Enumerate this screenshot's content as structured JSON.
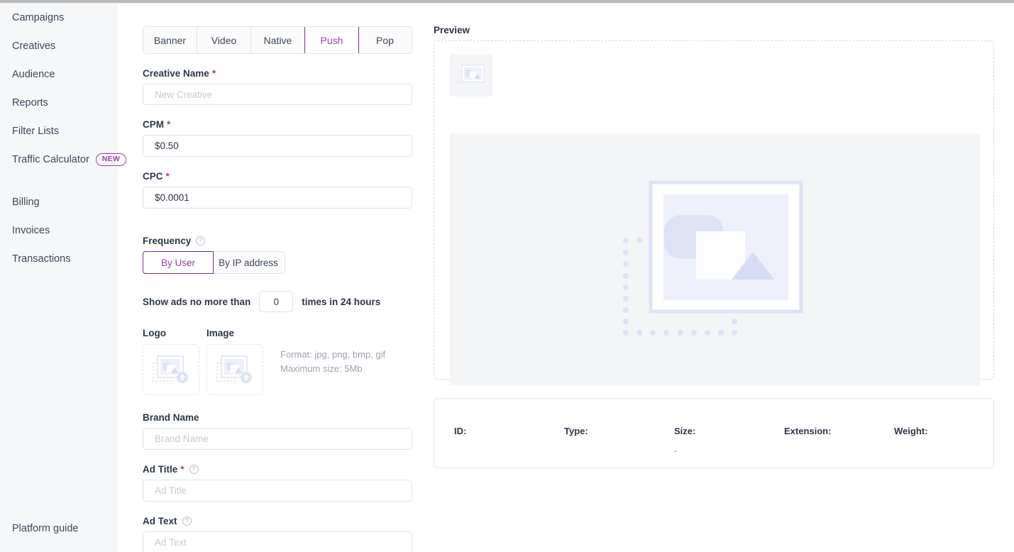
{
  "sidebar": {
    "items": [
      {
        "label": "Campaigns",
        "name": "campaigns"
      },
      {
        "label": "Creatives",
        "name": "creatives"
      },
      {
        "label": "Audience",
        "name": "audience"
      },
      {
        "label": "Reports",
        "name": "reports"
      },
      {
        "label": "Filter Lists",
        "name": "filter-lists"
      },
      {
        "label": "Traffic Calculator",
        "name": "traffic-calculator",
        "badge": "NEW"
      },
      {
        "label": "Billing",
        "name": "billing"
      },
      {
        "label": "Invoices",
        "name": "invoices"
      },
      {
        "label": "Transactions",
        "name": "transactions"
      }
    ],
    "footer_link": "Platform guide"
  },
  "creative_form": {
    "tabs": [
      {
        "label": "Banner",
        "active": false
      },
      {
        "label": "Video",
        "active": false
      },
      {
        "label": "Native",
        "active": false
      },
      {
        "label": "Push",
        "active": true
      },
      {
        "label": "Pop",
        "active": false
      }
    ],
    "creative_name": {
      "label": "Creative Name",
      "required": "*",
      "value": "",
      "placeholder": "New Creative"
    },
    "cpm": {
      "label": "CPM",
      "required": "*",
      "value": "$0.50",
      "placeholder": ""
    },
    "cpc": {
      "label": "CPC",
      "required": "*",
      "value": "$0.0001",
      "placeholder": ""
    },
    "frequency": {
      "label": "Frequency",
      "help_icon": "question-circle-icon",
      "options": [
        {
          "label": "By User",
          "active": true
        },
        {
          "label": "By IP address",
          "active": false
        }
      ],
      "limit_prefix": "Show ads no more than",
      "limit_value": "0",
      "limit_suffix": "times in 24 hours"
    },
    "uploads": {
      "logo_label": "Logo",
      "image_label": "Image",
      "format_note": "Format: jpg, png, bmp, gif",
      "size_note": "Maximum size: 5Mb",
      "icon": "image-upload-icon"
    },
    "brand_name": {
      "label": "Brand Name",
      "value": "",
      "placeholder": "Brand Name"
    },
    "ad_title": {
      "label": "Ad Title",
      "required": "*",
      "help_icon": "question-circle-icon",
      "value": "",
      "placeholder": "Ad Title"
    },
    "ad_text": {
      "label": "Ad Text",
      "help_icon": "question-circle-icon",
      "value": "",
      "placeholder": "Ad Text"
    }
  },
  "preview": {
    "title": "Preview",
    "placeholder_icon": "image-placeholder-icon",
    "meta": [
      {
        "label": "ID:",
        "value": ""
      },
      {
        "label": "Type:",
        "value": ""
      },
      {
        "label": "Size:",
        "value": "-"
      },
      {
        "label": "Extension:",
        "value": ""
      },
      {
        "label": "Weight:",
        "value": ""
      }
    ]
  },
  "colors": {
    "accent": "#9b3fa8",
    "accent_border": "#7b2d8e",
    "sidebar_bg": "#f6f7f9",
    "placeholder_blue": "#dde3f5",
    "panel_gray": "#f4f5f7"
  }
}
